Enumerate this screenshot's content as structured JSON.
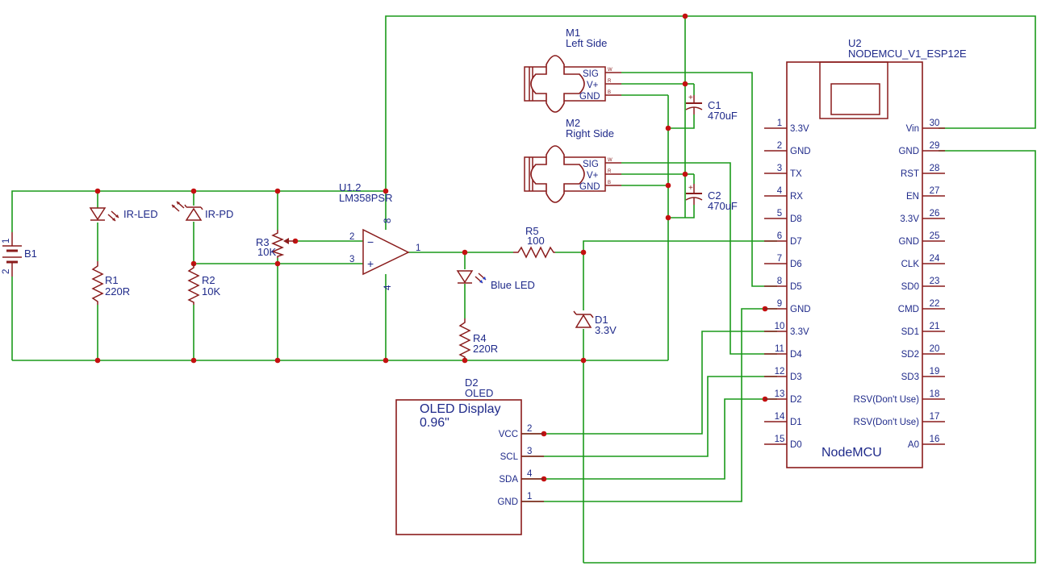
{
  "components": {
    "battery": {
      "ref": "B1",
      "pin_top": "1",
      "pin_bottom": "2"
    },
    "ir_led": {
      "name": "IR-LED"
    },
    "ir_pd": {
      "name": "IR-PD"
    },
    "r1": {
      "ref": "R1",
      "value": "220R"
    },
    "r2": {
      "ref": "R2",
      "value": "10K"
    },
    "r3": {
      "ref": "R3",
      "value": "10K"
    },
    "r4": {
      "ref": "R4",
      "value": "220R"
    },
    "r5": {
      "ref": "R5",
      "value": "100"
    },
    "opamp": {
      "ref": "U1.2",
      "part": "LM358PSR",
      "pin_minus": "2",
      "pin_plus": "3",
      "pin_out": "1",
      "pin_vcc": "8",
      "pin_gnd": "4"
    },
    "blue_led": {
      "name": "Blue LED"
    },
    "d1": {
      "ref": "D1",
      "value": "3.3V"
    },
    "c1": {
      "ref": "C1",
      "value": "470uF"
    },
    "c2": {
      "ref": "C2",
      "value": "470uF"
    },
    "m1": {
      "ref": "M1",
      "value": "Left Side",
      "pins": [
        "SIG",
        "V+",
        "GND"
      ],
      "wire_tags": [
        "W",
        "R",
        "B"
      ]
    },
    "m2": {
      "ref": "M2",
      "value": "Right Side",
      "pins": [
        "SIG",
        "V+",
        "GND"
      ],
      "wire_tags": [
        "W",
        "R",
        "B"
      ]
    },
    "oled": {
      "ref": "D2",
      "value": "OLED",
      "title_line1": "OLED Display",
      "title_line2": "0.96\"",
      "pins": [
        {
          "name": "VCC",
          "num": "2"
        },
        {
          "name": "SCL",
          "num": "3"
        },
        {
          "name": "SDA",
          "num": "4"
        },
        {
          "name": "GND",
          "num": "1"
        }
      ]
    },
    "mcu": {
      "ref": "U2",
      "part": "NODEMCU_V1_ESP12E",
      "body_label": "NodeMCU",
      "left_pins": [
        {
          "num": "1",
          "name": "3.3V"
        },
        {
          "num": "2",
          "name": "GND"
        },
        {
          "num": "3",
          "name": "TX"
        },
        {
          "num": "4",
          "name": "RX"
        },
        {
          "num": "5",
          "name": "D8"
        },
        {
          "num": "6",
          "name": "D7"
        },
        {
          "num": "7",
          "name": "D6"
        },
        {
          "num": "8",
          "name": "D5"
        },
        {
          "num": "9",
          "name": "GND"
        },
        {
          "num": "10",
          "name": "3.3V"
        },
        {
          "num": "11",
          "name": "D4"
        },
        {
          "num": "12",
          "name": "D3"
        },
        {
          "num": "13",
          "name": "D2"
        },
        {
          "num": "14",
          "name": "D1"
        },
        {
          "num": "15",
          "name": "D0"
        }
      ],
      "right_pins": [
        {
          "num": "30",
          "name": "Vin"
        },
        {
          "num": "29",
          "name": "GND"
        },
        {
          "num": "28",
          "name": "RST"
        },
        {
          "num": "27",
          "name": "EN"
        },
        {
          "num": "26",
          "name": "3.3V"
        },
        {
          "num": "25",
          "name": "GND"
        },
        {
          "num": "24",
          "name": "CLK"
        },
        {
          "num": "23",
          "name": "SD0"
        },
        {
          "num": "22",
          "name": "CMD"
        },
        {
          "num": "21",
          "name": "SD1"
        },
        {
          "num": "20",
          "name": "SD2"
        },
        {
          "num": "19",
          "name": "SD3"
        },
        {
          "num": "18",
          "name": "RSV(Don't Use)"
        },
        {
          "num": "17",
          "name": "RSV(Don't Use)"
        },
        {
          "num": "16",
          "name": "A0"
        }
      ]
    }
  },
  "colors": {
    "wire": "#1a9a1a",
    "component": "#8a1c1c",
    "text": "#1f2a8a",
    "junction": "#c41010"
  }
}
